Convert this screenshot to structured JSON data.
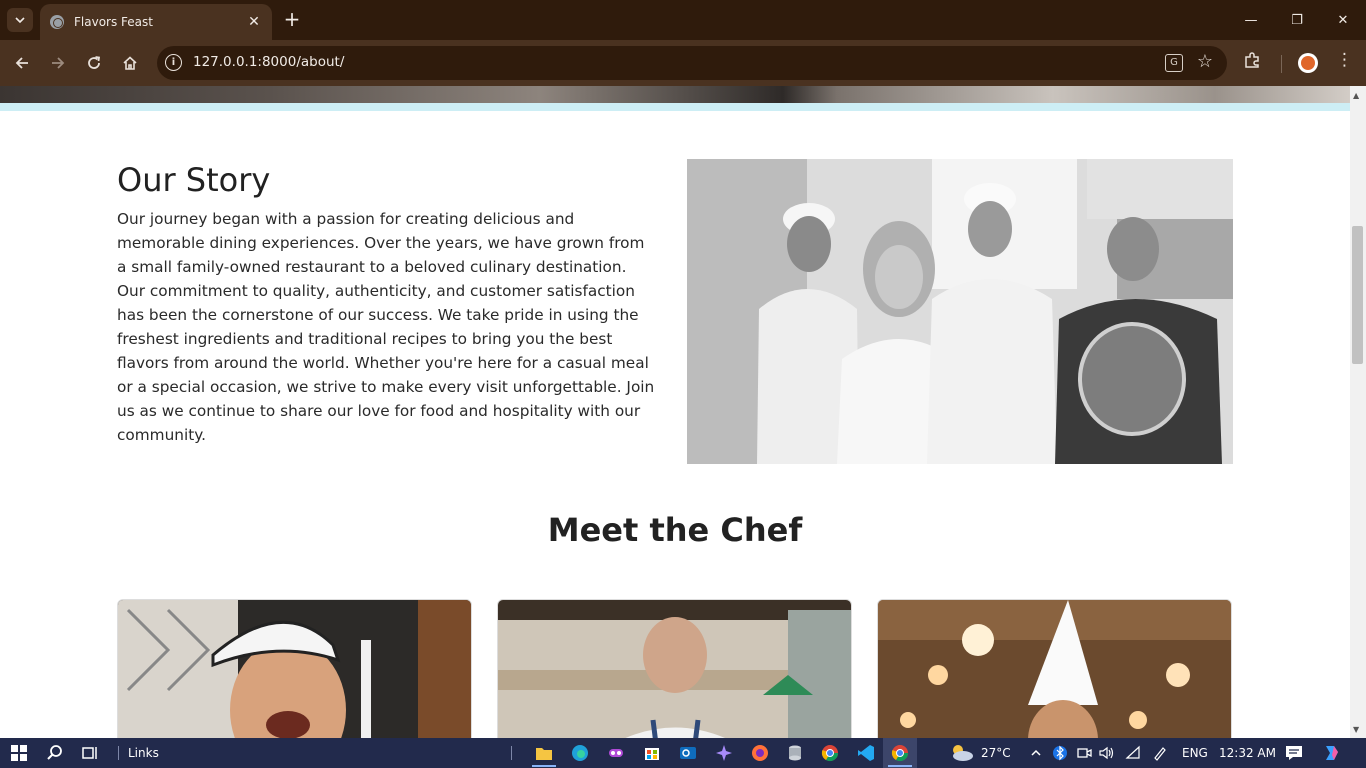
{
  "browser": {
    "tab_title": "Flavors Feast",
    "new_tab": "+",
    "close_tab": "✕",
    "url": "127.0.0.1:8000/about/",
    "window_controls": {
      "minimize": "—",
      "restore": "❐",
      "close": "✕"
    }
  },
  "page": {
    "story": {
      "title": "Our Story",
      "text": "Our journey began with a passion for creating delicious and memorable dining experiences. Over the years, we have grown from a small family-owned restaurant to a beloved culinary destination. Our commitment to quality, authenticity, and customer satisfaction has been the cornerstone of our success. We take pride in using the freshest ingredients and traditional recipes to bring you the best flavors from around the world. Whether you're here for a casual meal or a special occasion, we strive to make every visit unforgettable. Join us as we continue to share our love for food and hospitality with our community."
    },
    "meet_title": "Meet the Chef"
  },
  "taskbar": {
    "links_label": "Links",
    "weather": "27°C",
    "language": "ENG",
    "time": "12:32 AM"
  },
  "colors": {
    "tabbar": "#2f1b0c",
    "toolbar": "#4a3220",
    "accent_strip": "#cdeef5",
    "taskbar": "#222a4c"
  }
}
